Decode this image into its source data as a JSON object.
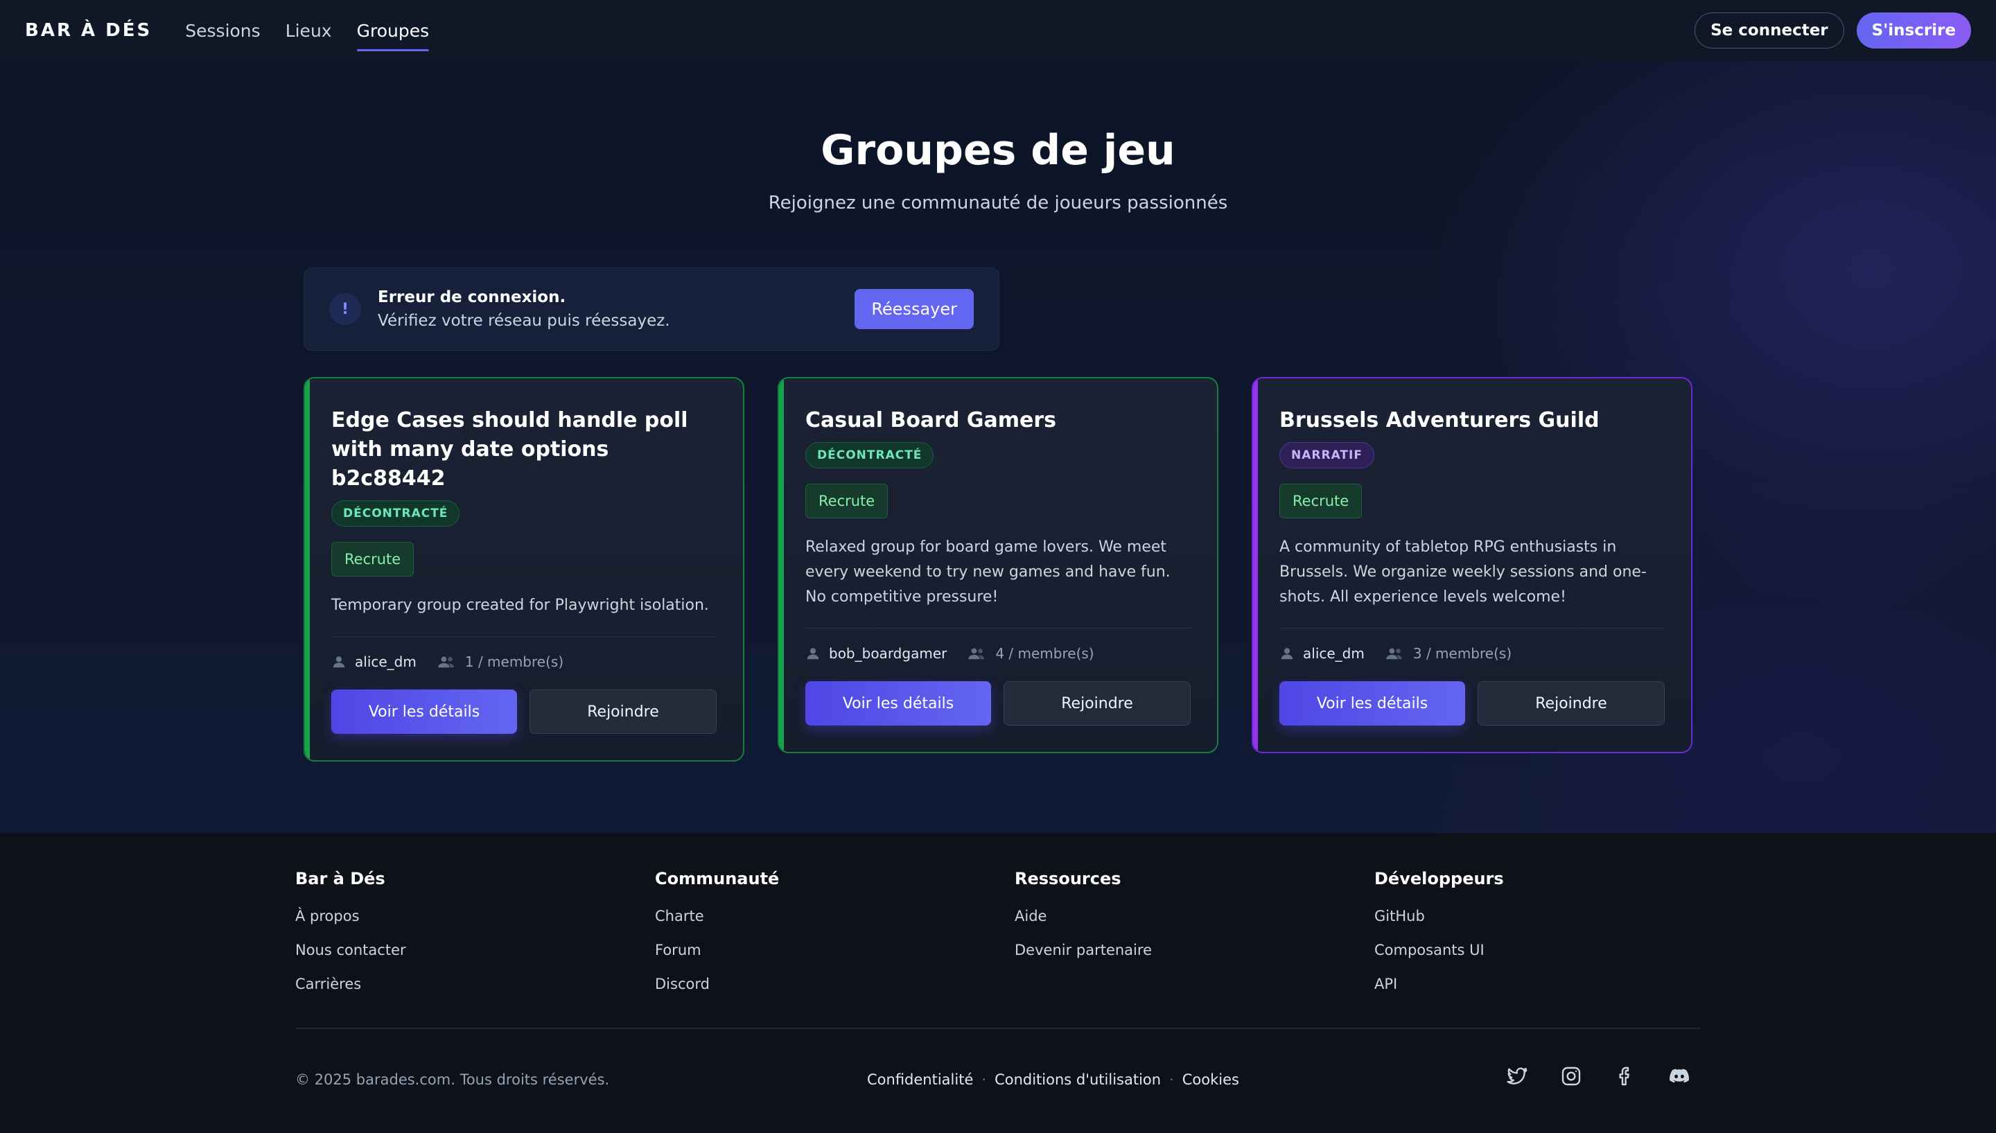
{
  "header": {
    "brand": "BAR À DÉS",
    "nav": [
      "Sessions",
      "Lieux",
      "Groupes"
    ],
    "active_nav": "Groupes",
    "login": "Se connecter",
    "signup": "S'inscrire"
  },
  "hero": {
    "title": "Groupes de jeu",
    "subtitle": "Rejoignez une communauté de joueurs passionnés"
  },
  "error": {
    "icon": "!",
    "title": "Erreur de connexion.",
    "message": "Vérifiez votre réseau puis réessayez.",
    "retry": "Réessayer"
  },
  "groups": [
    {
      "title": "Edge Cases should handle poll with many date options b2c88442",
      "style": "DÉCONTRACTÉ",
      "status": "Recrute",
      "description": "Temporary group created for Playwright isolation.",
      "owner": "alice_dm",
      "members": "1 / membre(s)",
      "details_label": "Voir les détails",
      "join_label": "Rejoindre"
    },
    {
      "title": "Casual Board Gamers",
      "style": "DÉCONTRACTÉ",
      "status": "Recrute",
      "description": "Relaxed group for board game lovers. We meet every weekend to try new games and have fun. No competitive pressure!",
      "owner": "bob_boardgamer",
      "members": "4 / membre(s)",
      "details_label": "Voir les détails",
      "join_label": "Rejoindre"
    },
    {
      "title": "Brussels Adventurers Guild",
      "style": "NARRATIF",
      "status": "Recrute",
      "description": "A community of tabletop RPG enthusiasts in Brussels. We organize weekly sessions and one-shots. All experience levels welcome!",
      "owner": "alice_dm",
      "members": "3 / membre(s)",
      "details_label": "Voir les détails",
      "join_label": "Rejoindre"
    }
  ],
  "footer": {
    "columns": [
      {
        "heading": "Bar à Dés",
        "links": [
          "À propos",
          "Nous contacter",
          "Carrières"
        ]
      },
      {
        "heading": "Communauté",
        "links": [
          "Charte",
          "Forum",
          "Discord"
        ]
      },
      {
        "heading": "Ressources",
        "links": [
          "Aide",
          "Devenir partenaire"
        ]
      },
      {
        "heading": "Développeurs",
        "links": [
          "GitHub",
          "Composants UI",
          "API"
        ]
      }
    ],
    "copyright": "© 2025 barades.com. Tous droits réservés.",
    "legal": [
      "Confidentialité",
      "Conditions d'utilisation",
      "Cookies"
    ],
    "legal_separator": "·",
    "socials": [
      "twitter-icon",
      "instagram-icon",
      "facebook-icon",
      "discord-icon"
    ]
  },
  "colors": {
    "accent": "#6366f1",
    "decontracte": "#16a34a",
    "narratif": "#9333ea",
    "background": "#0f172a"
  }
}
